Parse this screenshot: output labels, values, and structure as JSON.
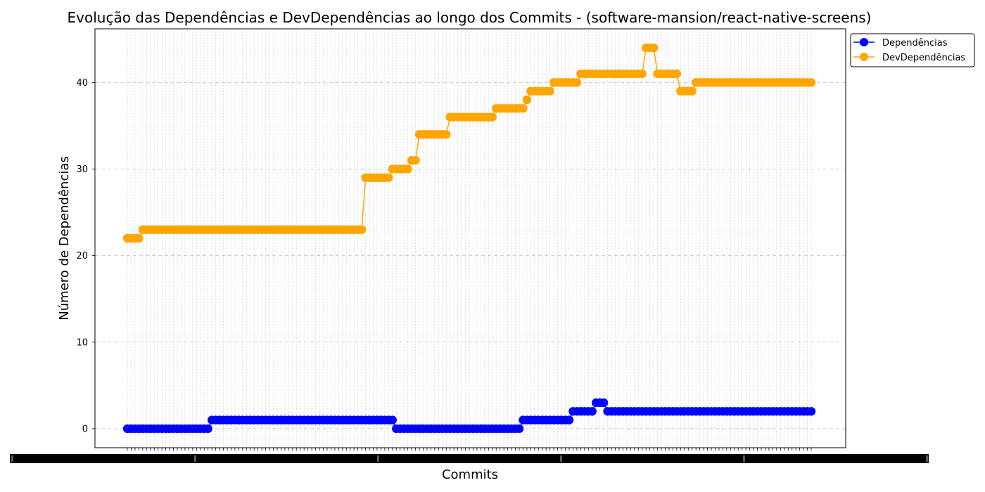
{
  "chart_data": {
    "type": "line",
    "title": "Evolução das Dependências e DevDependências ao longo dos Commits - (software-mansion/react-native-screens)",
    "xlabel": "Commits",
    "ylabel": "Número de Dependências",
    "ylim": [
      -2.2,
      46.2
    ],
    "yticks": [
      0,
      10,
      20,
      30,
      40
    ],
    "grid": true,
    "legend": "upper-right-outside",
    "x_tick_labels_note": "overlapping unreadable commit hash labels",
    "series": [
      {
        "name": "Dependências",
        "color": "#0000ff",
        "segments": [
          {
            "count": 22,
            "value": 0
          },
          {
            "count": 48,
            "value": 1
          },
          {
            "count": 33,
            "value": 0
          },
          {
            "count": 13,
            "value": 1
          },
          {
            "count": 6,
            "value": 2
          },
          {
            "count": 3,
            "value": 3
          },
          {
            "count": 54,
            "value": 2
          }
        ]
      },
      {
        "name": "DevDependências",
        "color": "#ffa500",
        "segments": [
          {
            "count": 4,
            "value": 22
          },
          {
            "count": 58,
            "value": 23
          },
          {
            "count": 7,
            "value": 29
          },
          {
            "count": 5,
            "value": 30
          },
          {
            "count": 2,
            "value": 31
          },
          {
            "count": 8,
            "value": 34
          },
          {
            "count": 12,
            "value": 36
          },
          {
            "count": 8,
            "value": 37
          },
          {
            "count": 1,
            "value": 38
          },
          {
            "count": 6,
            "value": 39
          },
          {
            "count": 7,
            "value": 40
          },
          {
            "count": 17,
            "value": 41
          },
          {
            "count": 3,
            "value": 44
          },
          {
            "count": 6,
            "value": 41
          },
          {
            "count": 4,
            "value": 39
          },
          {
            "count": 31,
            "value": 40
          }
        ]
      }
    ]
  }
}
